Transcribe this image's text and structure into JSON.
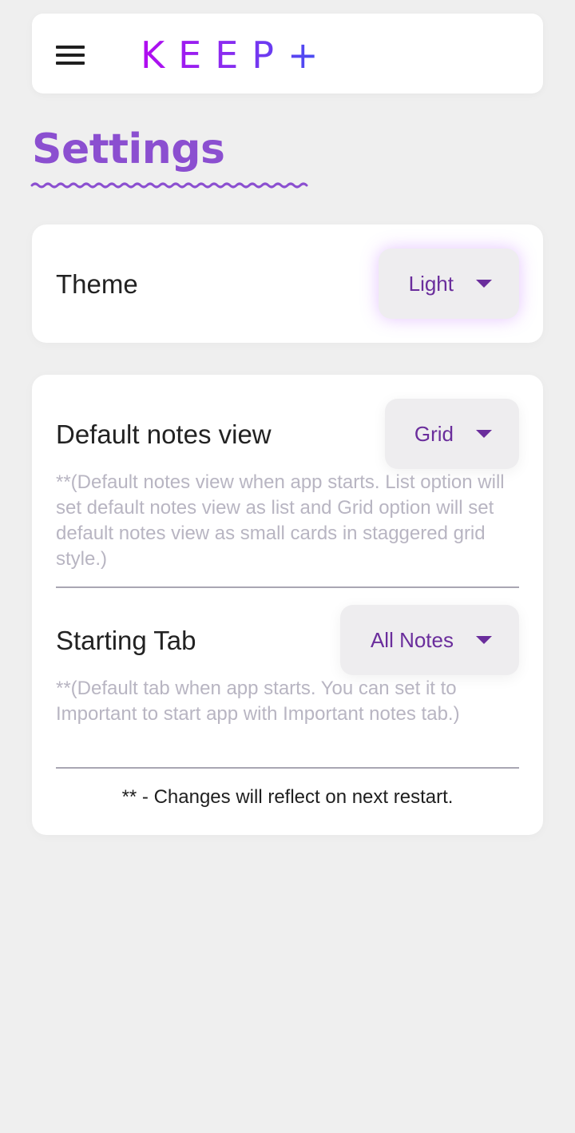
{
  "header": {
    "logo": "KEEP+",
    "menu_icon": "hamburger-menu-icon"
  },
  "page_title": "Settings",
  "theme_card": {
    "label": "Theme",
    "dropdown_value": "Light"
  },
  "prefs_card": {
    "default_view": {
      "label": "Default notes view",
      "dropdown_value": "Grid",
      "description": "**(Default notes view when app starts. List option will set default notes view as list and Grid option will set default notes view as small cards in staggered grid style.)"
    },
    "starting_tab": {
      "label": "Starting Tab",
      "dropdown_value": "All Notes",
      "description": "**(Default tab when app starts. You can set it to Important to start app with Important notes tab.)"
    },
    "footer_note": "** - Changes will reflect on next restart."
  },
  "colors": {
    "accent": "#8b4fd0",
    "dropdown_text": "#6a2d9c",
    "logo_gradient_start": "#b20bf0",
    "logo_gradient_end": "#3d52f2"
  }
}
